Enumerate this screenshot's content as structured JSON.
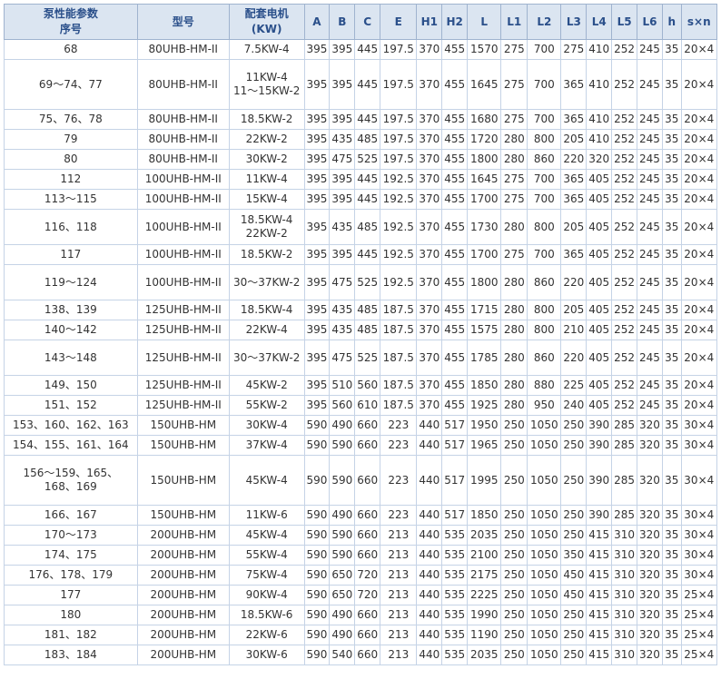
{
  "headers": [
    "泵性能参数\n序号",
    "型号",
    "配套电机\n(KW)",
    "A",
    "B",
    "C",
    "E",
    "H1",
    "H2",
    "L",
    "L1",
    "L2",
    "L3",
    "L4",
    "L5",
    "L6",
    "h",
    "s×n"
  ],
  "rows": [
    [
      "68",
      "80UHB-HM-II",
      "7.5KW-4",
      "395",
      "395",
      "445",
      "197.5",
      "370",
      "455",
      "1570",
      "275",
      "700",
      "275",
      "410",
      "252",
      "245",
      "35",
      "20×4"
    ],
    [
      "69～74、77",
      "80UHB-HM-II",
      "11KW-4\n11～15KW-2",
      "395",
      "395",
      "445",
      "197.5",
      "370",
      "455",
      "1645",
      "275",
      "700",
      "365",
      "410",
      "252",
      "245",
      "35",
      "20×4"
    ],
    [
      "75、76、78",
      "80UHB-HM-II",
      "18.5KW-2",
      "395",
      "395",
      "445",
      "197.5",
      "370",
      "455",
      "1680",
      "275",
      "700",
      "365",
      "410",
      "252",
      "245",
      "35",
      "20×4"
    ],
    [
      "79",
      "80UHB-HM-II",
      "22KW-2",
      "395",
      "435",
      "485",
      "197.5",
      "370",
      "455",
      "1720",
      "280",
      "800",
      "205",
      "410",
      "252",
      "245",
      "35",
      "20×4"
    ],
    [
      "80",
      "80UHB-HM-II",
      "30KW-2",
      "395",
      "475",
      "525",
      "197.5",
      "370",
      "455",
      "1800",
      "280",
      "860",
      "220",
      "320",
      "252",
      "245",
      "35",
      "20×4"
    ],
    [
      "112",
      "100UHB-HM-II",
      "11KW-4",
      "395",
      "395",
      "445",
      "192.5",
      "370",
      "455",
      "1645",
      "275",
      "700",
      "365",
      "405",
      "252",
      "245",
      "35",
      "20×4"
    ],
    [
      "113～115",
      "100UHB-HM-II",
      "15KW-4",
      "395",
      "395",
      "445",
      "192.5",
      "370",
      "455",
      "1700",
      "275",
      "700",
      "365",
      "405",
      "252",
      "245",
      "35",
      "20×4"
    ],
    [
      "116、118",
      "100UHB-HM-II",
      "18.5KW-4\n22KW-2",
      "395",
      "435",
      "485",
      "192.5",
      "370",
      "455",
      "1730",
      "280",
      "800",
      "205",
      "405",
      "252",
      "245",
      "35",
      "20×4"
    ],
    [
      "117",
      "100UHB-HM-II",
      "18.5KW-2",
      "395",
      "395",
      "445",
      "192.5",
      "370",
      "455",
      "1700",
      "275",
      "700",
      "365",
      "405",
      "252",
      "245",
      "35",
      "20×4"
    ],
    [
      "119～124",
      "100UHB-HM-II",
      "30～37KW-2",
      "395",
      "475",
      "525",
      "192.5",
      "370",
      "455",
      "1800",
      "280",
      "860",
      "220",
      "405",
      "252",
      "245",
      "35",
      "20×4"
    ],
    [
      "138、139",
      "125UHB-HM-II",
      "18.5KW-4",
      "395",
      "435",
      "485",
      "187.5",
      "370",
      "455",
      "1715",
      "280",
      "800",
      "205",
      "405",
      "252",
      "245",
      "35",
      "20×4"
    ],
    [
      "140～142",
      "125UHB-HM-II",
      "22KW-4",
      "395",
      "435",
      "485",
      "187.5",
      "370",
      "455",
      "1575",
      "280",
      "800",
      "210",
      "405",
      "252",
      "245",
      "35",
      "20×4"
    ],
    [
      "143～148",
      "125UHB-HM-II",
      "30～37KW-2",
      "395",
      "475",
      "525",
      "187.5",
      "370",
      "455",
      "1785",
      "280",
      "860",
      "220",
      "405",
      "252",
      "245",
      "35",
      "20×4"
    ],
    [
      "149、150",
      "125UHB-HM-II",
      "45KW-2",
      "395",
      "510",
      "560",
      "187.5",
      "370",
      "455",
      "1850",
      "280",
      "880",
      "225",
      "405",
      "252",
      "245",
      "35",
      "20×4"
    ],
    [
      "151、152",
      "125UHB-HM-II",
      "55KW-2",
      "395",
      "560",
      "610",
      "187.5",
      "370",
      "455",
      "1925",
      "280",
      "950",
      "240",
      "405",
      "252",
      "245",
      "35",
      "20×4"
    ],
    [
      "153、160、162、163",
      "150UHB-HM",
      "30KW-4",
      "590",
      "490",
      "660",
      "223",
      "440",
      "517",
      "1950",
      "250",
      "1050",
      "250",
      "390",
      "285",
      "320",
      "35",
      "30×4"
    ],
    [
      "154、155、161、164",
      "150UHB-HM",
      "37KW-4",
      "590",
      "590",
      "660",
      "223",
      "440",
      "517",
      "1965",
      "250",
      "1050",
      "250",
      "390",
      "285",
      "320",
      "35",
      "30×4"
    ],
    [
      "156～159、165、\n168、169",
      "150UHB-HM",
      "45KW-4",
      "590",
      "590",
      "660",
      "223",
      "440",
      "517",
      "1995",
      "250",
      "1050",
      "250",
      "390",
      "285",
      "320",
      "35",
      "30×4"
    ],
    [
      "166、167",
      "150UHB-HM",
      "11KW-6",
      "590",
      "490",
      "660",
      "223",
      "440",
      "517",
      "1850",
      "250",
      "1050",
      "250",
      "390",
      "285",
      "320",
      "35",
      "30×4"
    ],
    [
      "170～173",
      "200UHB-HM",
      "45KW-4",
      "590",
      "590",
      "660",
      "213",
      "440",
      "535",
      "2035",
      "250",
      "1050",
      "250",
      "415",
      "310",
      "320",
      "35",
      "30×4"
    ],
    [
      "174、175",
      "200UHB-HM",
      "55KW-4",
      "590",
      "590",
      "660",
      "213",
      "440",
      "535",
      "2100",
      "250",
      "1050",
      "350",
      "415",
      "310",
      "320",
      "35",
      "30×4"
    ],
    [
      "176、178、179",
      "200UHB-HM",
      "75KW-4",
      "590",
      "650",
      "720",
      "213",
      "440",
      "535",
      "2175",
      "250",
      "1050",
      "450",
      "415",
      "310",
      "320",
      "35",
      "30×4"
    ],
    [
      "177",
      "200UHB-HM",
      "90KW-4",
      "590",
      "650",
      "720",
      "213",
      "440",
      "535",
      "2225",
      "250",
      "1050",
      "450",
      "415",
      "310",
      "320",
      "35",
      "25×4"
    ],
    [
      "180",
      "200UHB-HM",
      "18.5KW-6",
      "590",
      "490",
      "660",
      "213",
      "440",
      "535",
      "1990",
      "250",
      "1050",
      "250",
      "415",
      "310",
      "320",
      "35",
      "25×4"
    ],
    [
      "181、182",
      "200UHB-HM",
      "22KW-6",
      "590",
      "490",
      "660",
      "213",
      "440",
      "535",
      "1190",
      "250",
      "1050",
      "250",
      "415",
      "310",
      "320",
      "35",
      "25×4"
    ],
    [
      "183、184",
      "200UHB-HM",
      "30KW-6",
      "590",
      "540",
      "660",
      "213",
      "440",
      "535",
      "2035",
      "250",
      "1050",
      "250",
      "415",
      "310",
      "320",
      "35",
      "25×4"
    ]
  ]
}
